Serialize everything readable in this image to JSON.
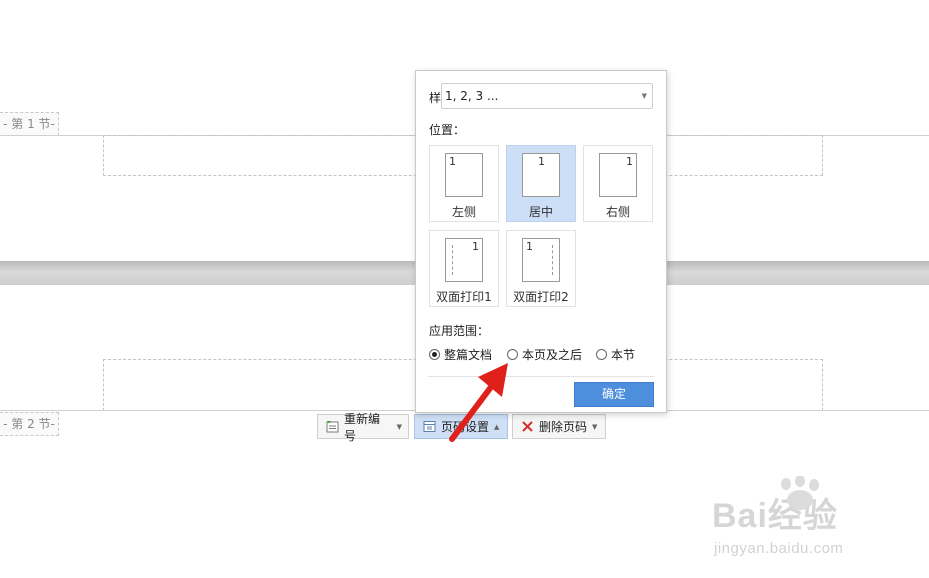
{
  "document": {
    "section1_label": "- 第 1 节-",
    "section2_label": "- 第 2 节-"
  },
  "toolbar": {
    "renumber_label": "重新编号",
    "page_settings_label": "页码设置",
    "delete_label": "删除页码"
  },
  "panel": {
    "style_label": "样式：",
    "style_value": "1, 2, 3 ...",
    "position_label": "位置：",
    "positions": [
      {
        "label": "左侧",
        "number": "1",
        "selected": false
      },
      {
        "label": "居中",
        "number": "1",
        "selected": true
      },
      {
        "label": "右侧",
        "number": "1",
        "selected": false
      },
      {
        "label": "双面打印1",
        "number": "1",
        "selected": false
      },
      {
        "label": "双面打印2",
        "number": "1",
        "selected": false
      }
    ],
    "range_label": "应用范围：",
    "range_options": [
      {
        "label": "整篇文档",
        "checked": true
      },
      {
        "label": "本页及之后",
        "checked": false
      },
      {
        "label": "本节",
        "checked": false
      }
    ],
    "ok_label": "确定"
  },
  "watermark": {
    "brand": "Bai经验",
    "url": "jingyan.baidu.com"
  },
  "colors": {
    "accent": "#4d8fdc",
    "selected_bg": "#cddff6",
    "arrow": "#e0201b"
  }
}
